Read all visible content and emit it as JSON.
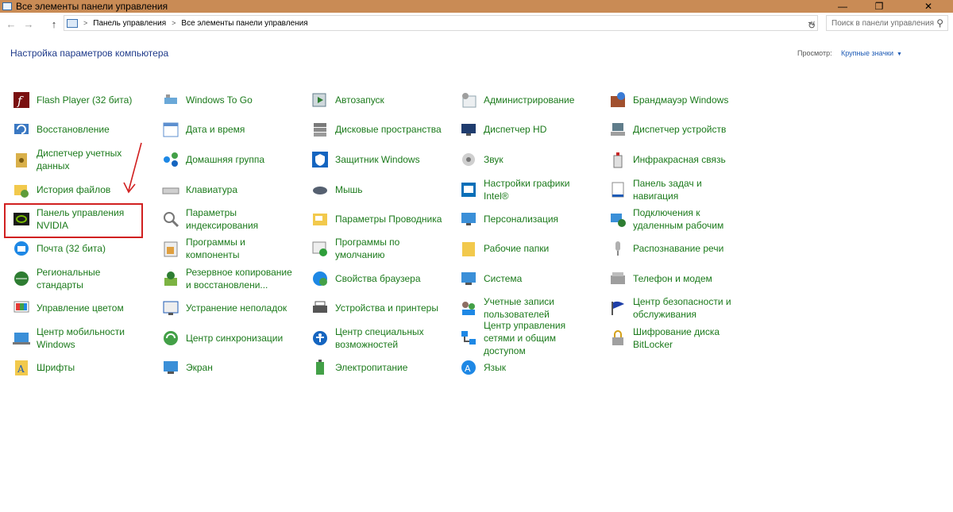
{
  "window": {
    "title": "Все элементы панели управления",
    "minimize": "—",
    "maximize": "❐",
    "close": "✕"
  },
  "address": {
    "back": "←",
    "forward": "→",
    "up": "↑",
    "crumb1": "Панель управления",
    "crumb2": "Все элементы панели управления",
    "separator": ">",
    "dropdown": "∨",
    "refresh": "↻"
  },
  "search": {
    "placeholder": "Поиск в панели управления",
    "icon": "⚲"
  },
  "header": {
    "title": "Настройка параметров компьютера",
    "view_label": "Просмотр:",
    "view_value": "Крупные значки",
    "view_caret": "▼"
  },
  "items": [
    [
      "Flash Player (32 бита)",
      "Windows To Go",
      "Автозапуск",
      "Администрирование",
      "Брандмауэр Windows"
    ],
    [
      "Восстановление",
      "Дата и время",
      "Дисковые пространства",
      "Диспетчер HD",
      "Диспетчер устройств"
    ],
    [
      "Диспетчер учетных данных",
      "Домашняя группа",
      "Защитник Windows",
      "Звук",
      "Инфракрасная связь"
    ],
    [
      "История файлов",
      "Клавиатура",
      "Мышь",
      "Настройки графики Intel®",
      "Панель задач и навигация"
    ],
    [
      "Панель управления NVIDIA",
      "Параметры индексирования",
      "Параметры Проводника",
      "Персонализация",
      "Подключения к удаленным рабочим"
    ],
    [
      "Почта (32 бита)",
      "Программы и компоненты",
      "Программы по умолчанию",
      "Рабочие папки",
      "Распознавание речи"
    ],
    [
      "Региональные стандарты",
      "Резервное копирование и восстановлени...",
      "Свойства браузера",
      "Система",
      "Телефон и модем"
    ],
    [
      "Управление цветом",
      "Устранение неполадок",
      "Устройства и принтеры",
      "Учетные записи пользователей",
      "Центр безопасности и обслуживания"
    ],
    [
      "Центр мобильности Windows",
      "Центр синхронизации",
      "Центр специальных возможностей",
      "Центр управления сетями и общим доступом",
      "Шифрование диска BitLocker"
    ],
    [
      "Шрифты",
      "Экран",
      "Электропитание",
      "Язык",
      ""
    ]
  ],
  "colors": {
    "titlebar": "#c98b55",
    "link_green": "#1b7a1b",
    "header_blue": "#1e3a8a",
    "highlight_red": "#d12020"
  }
}
